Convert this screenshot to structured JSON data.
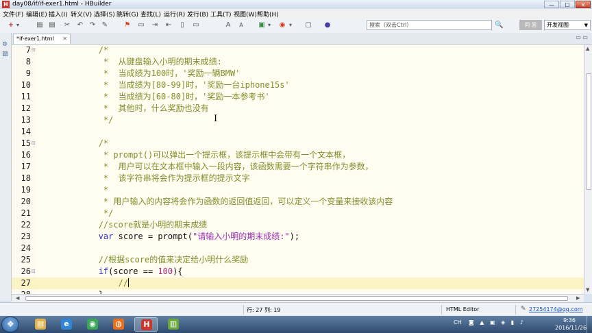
{
  "window": {
    "title": "day08/if/if-exer1.html - HBuilder",
    "app_icon": "H",
    "minimize_glyph": "—",
    "maximize_glyph": "☐",
    "close_glyph": "✕"
  },
  "menu": [
    "文件(F)",
    "编辑(E)",
    "插入(I)",
    "转义(V)",
    "选择(S)",
    "跳转(G)",
    "查找(L)",
    "运行(R)",
    "发行(B)",
    "工具(T)",
    "视图(W)",
    "帮助(H)"
  ],
  "toolbar": {
    "search_placeholder": "搜索（双击Ctrl）",
    "search_icon": "🔍",
    "help_label": "问 答",
    "view_label": "开发视图",
    "view_arrow": "▼",
    "icons": [
      "plus-icon",
      "save-icon",
      "save-all-icon",
      "cut-icon",
      "undo-icon",
      "redo-icon",
      "bookmark-icon",
      "format-icon",
      "indent-icon",
      "outdent-icon",
      "comment-icon",
      "uncomment-icon",
      "font-up-icon",
      "font-down-icon",
      "browser-icon",
      "run-icon",
      "preview-icon",
      "globe-icon"
    ],
    "glyphs": [
      "+",
      "▾",
      "▤",
      "▤",
      "✂",
      "↶",
      "↷",
      "✎",
      "⚑",
      "▭",
      "⇥",
      "⇤",
      "▯",
      "▭",
      "A",
      "A",
      "▣",
      "▾",
      "◉",
      "▾",
      "▢",
      "●"
    ]
  },
  "left_icons": [
    "⚙",
    "▧"
  ],
  "tab": {
    "label": "*if-exer1.html",
    "close_glyph": "✕",
    "maximize_glyph": "▭ ▭"
  },
  "editor": {
    "lines": [
      {
        "n": "7",
        "fold": "⊟",
        "hl": false,
        "segs": [
          {
            "t": "            ",
            "c": "pl"
          },
          {
            "t": "/*",
            "c": "cmt"
          }
        ]
      },
      {
        "n": "8",
        "fold": "",
        "hl": false,
        "segs": [
          {
            "t": "             *  从键盘输入小明的期末成绩:",
            "c": "cmt"
          }
        ]
      },
      {
        "n": "9",
        "fold": "",
        "hl": false,
        "segs": [
          {
            "t": "             *  当成绩为100时，'奖励一辆BMW'",
            "c": "cmt"
          }
        ]
      },
      {
        "n": "10",
        "fold": "",
        "hl": false,
        "segs": [
          {
            "t": "             *  当成绩为[80-99]时，'奖励一台iphone15s'",
            "c": "cmt"
          }
        ]
      },
      {
        "n": "11",
        "fold": "",
        "hl": false,
        "segs": [
          {
            "t": "             *  当成绩为[60-80]时，'奖励一本参考书'",
            "c": "cmt"
          }
        ]
      },
      {
        "n": "12",
        "fold": "",
        "hl": false,
        "segs": [
          {
            "t": "             *  其他时，什么奖励也没有",
            "c": "cmt"
          }
        ]
      },
      {
        "n": "13",
        "fold": "",
        "hl": false,
        "segs": [
          {
            "t": "             */",
            "c": "cmt"
          }
        ]
      },
      {
        "n": "14",
        "fold": "",
        "hl": false,
        "segs": [
          {
            "t": "",
            "c": "pl"
          }
        ]
      },
      {
        "n": "15",
        "fold": "⊟",
        "hl": false,
        "segs": [
          {
            "t": "            /*",
            "c": "cmt"
          }
        ]
      },
      {
        "n": "16",
        "fold": "",
        "hl": false,
        "segs": [
          {
            "t": "             * prompt()可以弹出一个提示框，该提示框中会带有一个文本框，",
            "c": "cmt"
          }
        ]
      },
      {
        "n": "17",
        "fold": "",
        "hl": false,
        "segs": [
          {
            "t": "             *  用户可以在文本框中输入一段内容，该函数需要一个字符串作为参数，",
            "c": "cmt"
          }
        ]
      },
      {
        "n": "18",
        "fold": "",
        "hl": false,
        "segs": [
          {
            "t": "             *  该字符串将会作为提示框的提示文字",
            "c": "cmt"
          }
        ]
      },
      {
        "n": "19",
        "fold": "",
        "hl": false,
        "segs": [
          {
            "t": "             *",
            "c": "cmt"
          }
        ]
      },
      {
        "n": "20",
        "fold": "",
        "hl": false,
        "segs": [
          {
            "t": "             * 用户输入的内容将会作为函数的返回值返回，可以定义一个变量来接收该内容",
            "c": "cmt"
          }
        ]
      },
      {
        "n": "21",
        "fold": "",
        "hl": false,
        "segs": [
          {
            "t": "             */",
            "c": "cmt"
          }
        ]
      },
      {
        "n": "22",
        "fold": "",
        "hl": false,
        "segs": [
          {
            "t": "            //score就是小明的期末成绩",
            "c": "cmt"
          }
        ]
      },
      {
        "n": "23",
        "fold": "",
        "hl": false,
        "segs": [
          {
            "t": "            ",
            "c": "pl"
          },
          {
            "t": "var",
            "c": "kw"
          },
          {
            "t": " score = prompt(",
            "c": "pl"
          },
          {
            "t": "\"请输入小明的期末成绩:\"",
            "c": "str"
          },
          {
            "t": ");",
            "c": "pl"
          }
        ]
      },
      {
        "n": "24",
        "fold": "",
        "hl": false,
        "segs": [
          {
            "t": "",
            "c": "pl"
          }
        ]
      },
      {
        "n": "25",
        "fold": "",
        "hl": false,
        "segs": [
          {
            "t": "            //根据score的值来决定给小明什么奖励",
            "c": "cmt"
          }
        ]
      },
      {
        "n": "26",
        "fold": "⊟",
        "hl": false,
        "segs": [
          {
            "t": "            ",
            "c": "pl"
          },
          {
            "t": "if",
            "c": "kw"
          },
          {
            "t": "(score == ",
            "c": "pl"
          },
          {
            "t": "100",
            "c": "num"
          },
          {
            "t": "){",
            "c": "pl"
          }
        ]
      },
      {
        "n": "27",
        "fold": "",
        "hl": true,
        "caret": true,
        "segs": [
          {
            "t": "                //",
            "c": "cmt"
          }
        ]
      },
      {
        "n": "28",
        "fold": "",
        "hl": false,
        "segs": [
          {
            "t": "            }",
            "c": "pl"
          }
        ]
      }
    ],
    "ibeam": "I"
  },
  "scroll": {
    "up": "▲",
    "down": "▼",
    "left": "◀",
    "right": "▶"
  },
  "status": {
    "position": "行: 27 列: 19",
    "mode": "HTML Editor",
    "user_icon": "✎",
    "user": "27254174@qq.com"
  },
  "taskbar": {
    "start_glyph": "❖",
    "apps": [
      {
        "name": "explorer-task",
        "glyph": "▤",
        "color": "#e2b24a",
        "active": false
      },
      {
        "name": "ie-task",
        "glyph": "e",
        "color": "#2f86d6",
        "active": false
      },
      {
        "name": "chrome-task",
        "glyph": "◉",
        "color": "#3aa757",
        "active": false
      },
      {
        "name": "firefox-task",
        "glyph": "◍",
        "color": "#e8701a",
        "active": false
      },
      {
        "name": "hbuilder-task",
        "glyph": "H",
        "color": "#c8372d",
        "active": true
      },
      {
        "name": "camtasia-task",
        "glyph": "▥",
        "color": "#6aa83a",
        "active": false
      }
    ],
    "ime": "CH",
    "tray_glyphs": "◙ ▲ ▣ ◈ ▮ ♪",
    "time": "9:36",
    "date": "2016/11/26"
  }
}
